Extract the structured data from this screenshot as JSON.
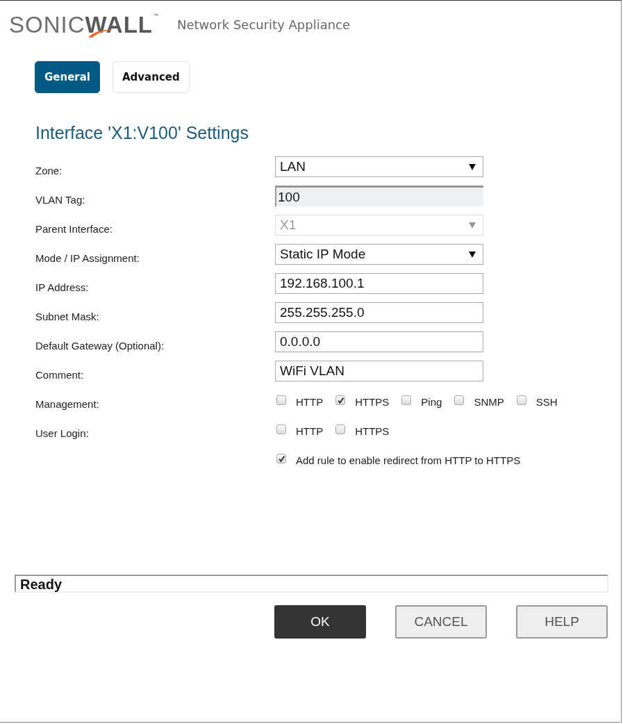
{
  "header": {
    "logo": {
      "light": "SONIC",
      "bold": "WALL",
      "mark": "™"
    },
    "product": "Network Security Appliance"
  },
  "tabs": [
    {
      "label": "General",
      "selected": true
    },
    {
      "label": "Advanced",
      "selected": false
    }
  ],
  "title": "Interface 'X1:V100' Settings",
  "fields": [
    {
      "label": "Zone:",
      "kind": "select",
      "value": "LAN",
      "disabled": false
    },
    {
      "label": "VLAN Tag:",
      "kind": "readonly",
      "value": "100",
      "disabled": false
    },
    {
      "label": "Parent Interface:",
      "kind": "select",
      "value": "X1",
      "disabled": true
    },
    {
      "label": "Mode / IP Assignment:",
      "kind": "select",
      "value": "Static IP Mode",
      "disabled": false
    },
    {
      "label": "IP Address:",
      "kind": "input",
      "value": "192.168.100.1",
      "disabled": false
    },
    {
      "label": "Subnet Mask:",
      "kind": "input",
      "value": "255.255.255.0",
      "disabled": false
    },
    {
      "label": "Default Gateway (Optional):",
      "kind": "input",
      "value": "0.0.0.0",
      "disabled": false
    },
    {
      "label": "Comment:",
      "kind": "input",
      "value": "WiFi VLAN",
      "disabled": false
    },
    {
      "label": "Management:",
      "kind": "checks",
      "options": [
        {
          "label": "HTTP",
          "checked": false
        },
        {
          "label": "HTTPS",
          "checked": true
        },
        {
          "label": "Ping",
          "checked": false
        },
        {
          "label": "SNMP",
          "checked": false
        },
        {
          "label": "SSH",
          "checked": false
        }
      ]
    },
    {
      "label": "User Login:",
      "kind": "checks",
      "options": [
        {
          "label": "HTTP",
          "checked": false
        },
        {
          "label": "HTTPS",
          "checked": false
        }
      ]
    },
    {
      "kind": "checks",
      "options": [
        {
          "label": "Add rule to enable redirect from HTTP to HTTPS",
          "checked": true
        }
      ]
    }
  ],
  "status_bar": "Ready",
  "buttons": [
    {
      "label": "OK",
      "kind": "primary"
    },
    {
      "label": "CANCEL",
      "kind": "secondary"
    },
    {
      "label": "HELP",
      "kind": "secondary"
    }
  ]
}
